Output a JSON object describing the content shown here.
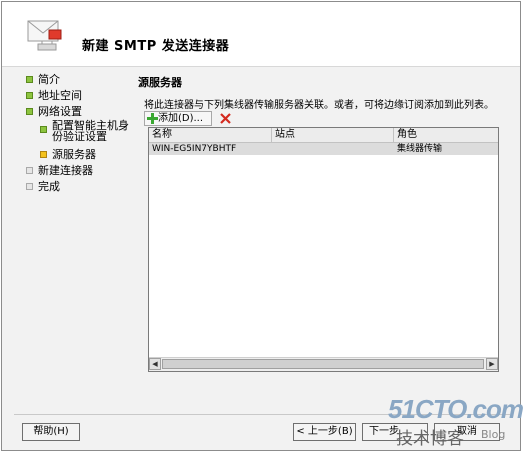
{
  "wizard": {
    "title": "新建 SMTP 发送连接器"
  },
  "nav": {
    "items": [
      {
        "label": "简介",
        "state": "green"
      },
      {
        "label": "地址空间",
        "state": "green"
      },
      {
        "label": "网络设置",
        "state": "green"
      },
      {
        "label": "配置智能主机身份验证设置",
        "state": "green"
      },
      {
        "label": "源服务器",
        "state": "yellow"
      },
      {
        "label": "新建连接器",
        "state": "gray"
      },
      {
        "label": "完成",
        "state": "gray"
      }
    ]
  },
  "panel": {
    "title": "源服务器",
    "description": "将此连接器与下列集线器传输服务器关联。或者，可将边缘订阅添加到此列表。",
    "add_label": "添加(D)...",
    "columns": [
      "名称",
      "站点",
      "角色"
    ],
    "rows": [
      {
        "name": "WIN-EG5IN7YBHTF",
        "site": "",
        "role": "集线器传输"
      }
    ]
  },
  "buttons": {
    "help": "帮助(H)",
    "back": "< 上一步(B)",
    "next": "下一步",
    "cancel": "取消"
  },
  "watermark": {
    "main": "51CTO.com",
    "sub": "技术博客",
    "blog": "Blog"
  },
  "colors": {
    "complete": "#8dc43f",
    "current": "#f4c21c",
    "pending": "#e6e6e6",
    "selected_row": "#dcdcdc"
  }
}
